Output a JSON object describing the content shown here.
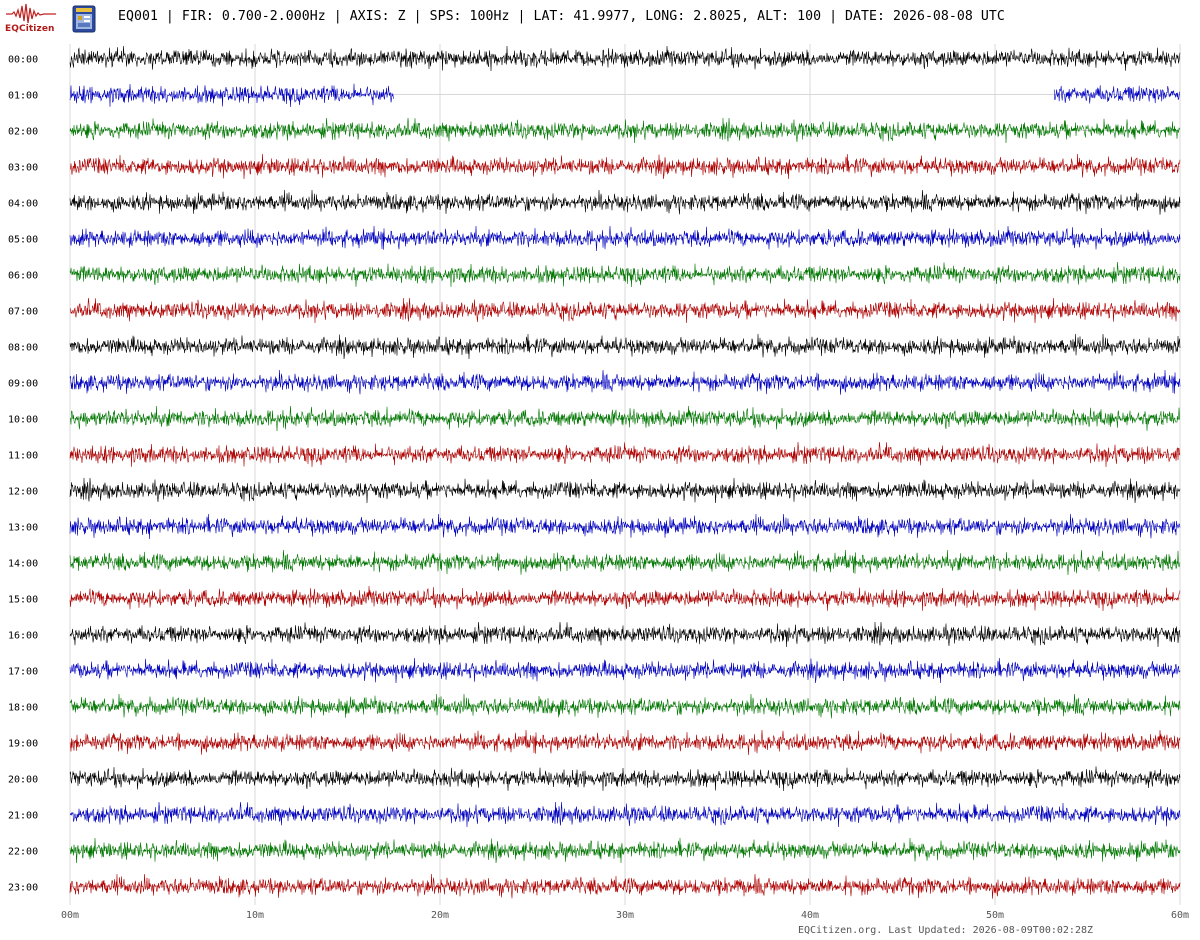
{
  "header": {
    "logo_text": "EQCitizen",
    "station_line": "EQ001 | FIR: 0.700-2.000Hz | AXIS: Z | SPS: 100Hz | LAT: 41.9977, LONG: 2.8025, ALT: 100 | DATE: 2026-08-08 UTC"
  },
  "footer": {
    "text": "EQCitizen.org. Last Updated: 2026-08-09T00:02:28Z"
  },
  "icons": {
    "logo": "seismograph-logo-icon",
    "sd_card": "sd-card-icon"
  },
  "colors": {
    "trace_cycle": [
      "#000000",
      "#0000c0",
      "#007800",
      "#b00000"
    ],
    "grid": "#d8d8d8",
    "logo": "#c02020"
  },
  "chart_data": {
    "type": "line",
    "title": "",
    "xlabel": "",
    "ylabel": "",
    "xlim": [
      0,
      60
    ],
    "x_tick_labels": [
      "00m",
      "10m",
      "20m",
      "30m",
      "40m",
      "50m",
      "60m"
    ],
    "rows": [
      {
        "label": "00:00",
        "data_segments": [
          [
            0,
            60
          ]
        ]
      },
      {
        "label": "01:00",
        "data_segments": [
          [
            0,
            17.5
          ],
          [
            53.2,
            60
          ]
        ]
      },
      {
        "label": "02:00",
        "data_segments": [
          [
            0,
            60
          ]
        ]
      },
      {
        "label": "03:00",
        "data_segments": [
          [
            0,
            60
          ]
        ]
      },
      {
        "label": "04:00",
        "data_segments": [
          [
            0,
            60
          ]
        ]
      },
      {
        "label": "05:00",
        "data_segments": [
          [
            0,
            60
          ]
        ]
      },
      {
        "label": "06:00",
        "data_segments": [
          [
            0,
            60
          ]
        ]
      },
      {
        "label": "07:00",
        "data_segments": [
          [
            0,
            60
          ]
        ]
      },
      {
        "label": "08:00",
        "data_segments": [
          [
            0,
            60
          ]
        ]
      },
      {
        "label": "09:00",
        "data_segments": [
          [
            0,
            60
          ]
        ]
      },
      {
        "label": "10:00",
        "data_segments": [
          [
            0,
            60
          ]
        ]
      },
      {
        "label": "11:00",
        "data_segments": [
          [
            0,
            60
          ]
        ]
      },
      {
        "label": "12:00",
        "data_segments": [
          [
            0,
            60
          ]
        ]
      },
      {
        "label": "13:00",
        "data_segments": [
          [
            0,
            60
          ]
        ]
      },
      {
        "label": "14:00",
        "data_segments": [
          [
            0,
            60
          ]
        ]
      },
      {
        "label": "15:00",
        "data_segments": [
          [
            0,
            60
          ]
        ]
      },
      {
        "label": "16:00",
        "data_segments": [
          [
            0,
            60
          ]
        ]
      },
      {
        "label": "17:00",
        "data_segments": [
          [
            0,
            60
          ]
        ]
      },
      {
        "label": "18:00",
        "data_segments": [
          [
            0,
            60
          ]
        ]
      },
      {
        "label": "19:00",
        "data_segments": [
          [
            0,
            60
          ]
        ]
      },
      {
        "label": "20:00",
        "data_segments": [
          [
            0,
            60
          ]
        ]
      },
      {
        "label": "21:00",
        "data_segments": [
          [
            0,
            60
          ]
        ]
      },
      {
        "label": "22:00",
        "data_segments": [
          [
            0,
            60
          ]
        ]
      },
      {
        "label": "23:00",
        "data_segments": [
          [
            0,
            60
          ]
        ]
      }
    ],
    "grid": true
  }
}
